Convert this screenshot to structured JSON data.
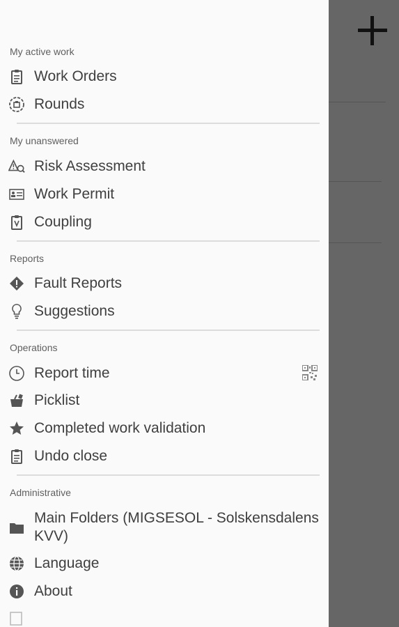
{
  "colors": {
    "drawer_bg": "#fafafa",
    "backdrop": "#666666",
    "icon": "#555555",
    "text": "#3f3f3f",
    "header": "#5f5f5f"
  },
  "sections": {
    "active_work": {
      "header": "My active work",
      "items": [
        {
          "label": "Work Orders",
          "icon": "clipboard-icon"
        },
        {
          "label": "Rounds",
          "icon": "rounds-icon"
        }
      ]
    },
    "unanswered": {
      "header": "My unanswered",
      "items": [
        {
          "label": "Risk Assessment",
          "icon": "risk-assessment-icon"
        },
        {
          "label": "Work Permit",
          "icon": "work-permit-icon"
        },
        {
          "label": "Coupling",
          "icon": "coupling-icon"
        }
      ]
    },
    "reports": {
      "header": "Reports",
      "items": [
        {
          "label": "Fault Reports",
          "icon": "fault-report-icon"
        },
        {
          "label": "Suggestions",
          "icon": "lightbulb-icon"
        }
      ]
    },
    "operations": {
      "header": "Operations",
      "items": [
        {
          "label": "Report time",
          "icon": "clock-icon"
        },
        {
          "label": "Picklist",
          "icon": "basket-icon"
        },
        {
          "label": "Completed work validation",
          "icon": "star-icon"
        },
        {
          "label": "Undo close",
          "icon": "clipboard-icon"
        }
      ]
    },
    "administrative": {
      "header": "Administrative",
      "items": [
        {
          "label": "Main Folders (MIGSESOL - Solskensdalens KVV)",
          "icon": "folder-icon"
        },
        {
          "label": "Language",
          "icon": "globe-icon"
        },
        {
          "label": "About",
          "icon": "info-icon"
        }
      ]
    }
  }
}
